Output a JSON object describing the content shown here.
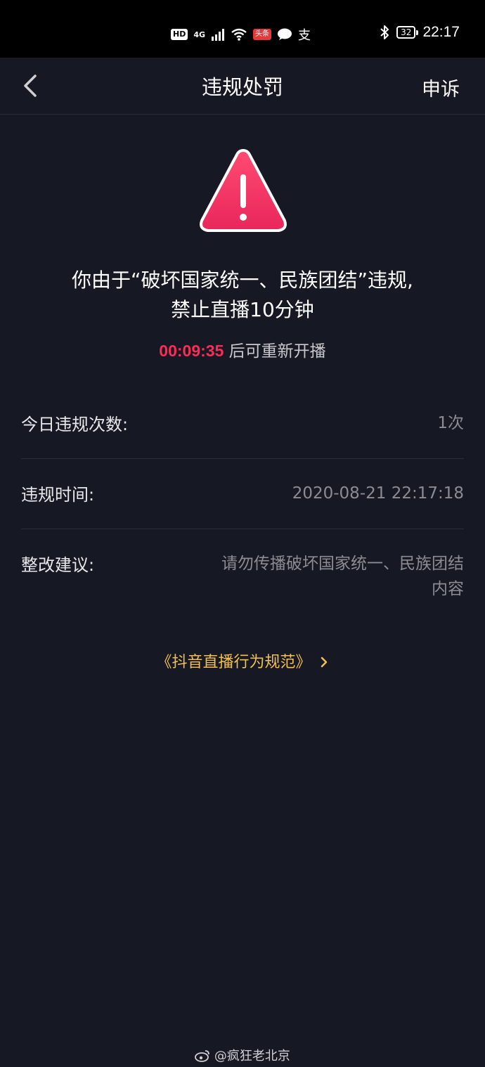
{
  "status_bar": {
    "hd": "HD",
    "network": "4G",
    "app_badge": "头条",
    "chinese_char": "支",
    "battery": "32",
    "time": "22:17"
  },
  "nav": {
    "title": "违规处罚",
    "appeal": "申诉",
    "back_icon": "chevron-left-icon"
  },
  "penalty": {
    "icon": "warning-icon",
    "message_line1": "你由于“破坏国家统一、民族团结”违规,",
    "message_line2": "禁止直播10分钟",
    "countdown": "00:09:35",
    "countdown_suffix": " 后可重新开播",
    "accent_color": "#fe2c55"
  },
  "details": [
    {
      "label": "今日违规次数:",
      "value": "1次"
    },
    {
      "label": "违规时间:",
      "value": "2020-08-21 22:17:18"
    },
    {
      "label": "整改建议:",
      "value_line1": "请勿传播破坏国家统一、民族团结",
      "value_line2": "内容"
    }
  ],
  "rules_link": "《抖音直播行为规范》",
  "rules_link_color": "#f3c04f",
  "watermark": "@疯狂老北京"
}
